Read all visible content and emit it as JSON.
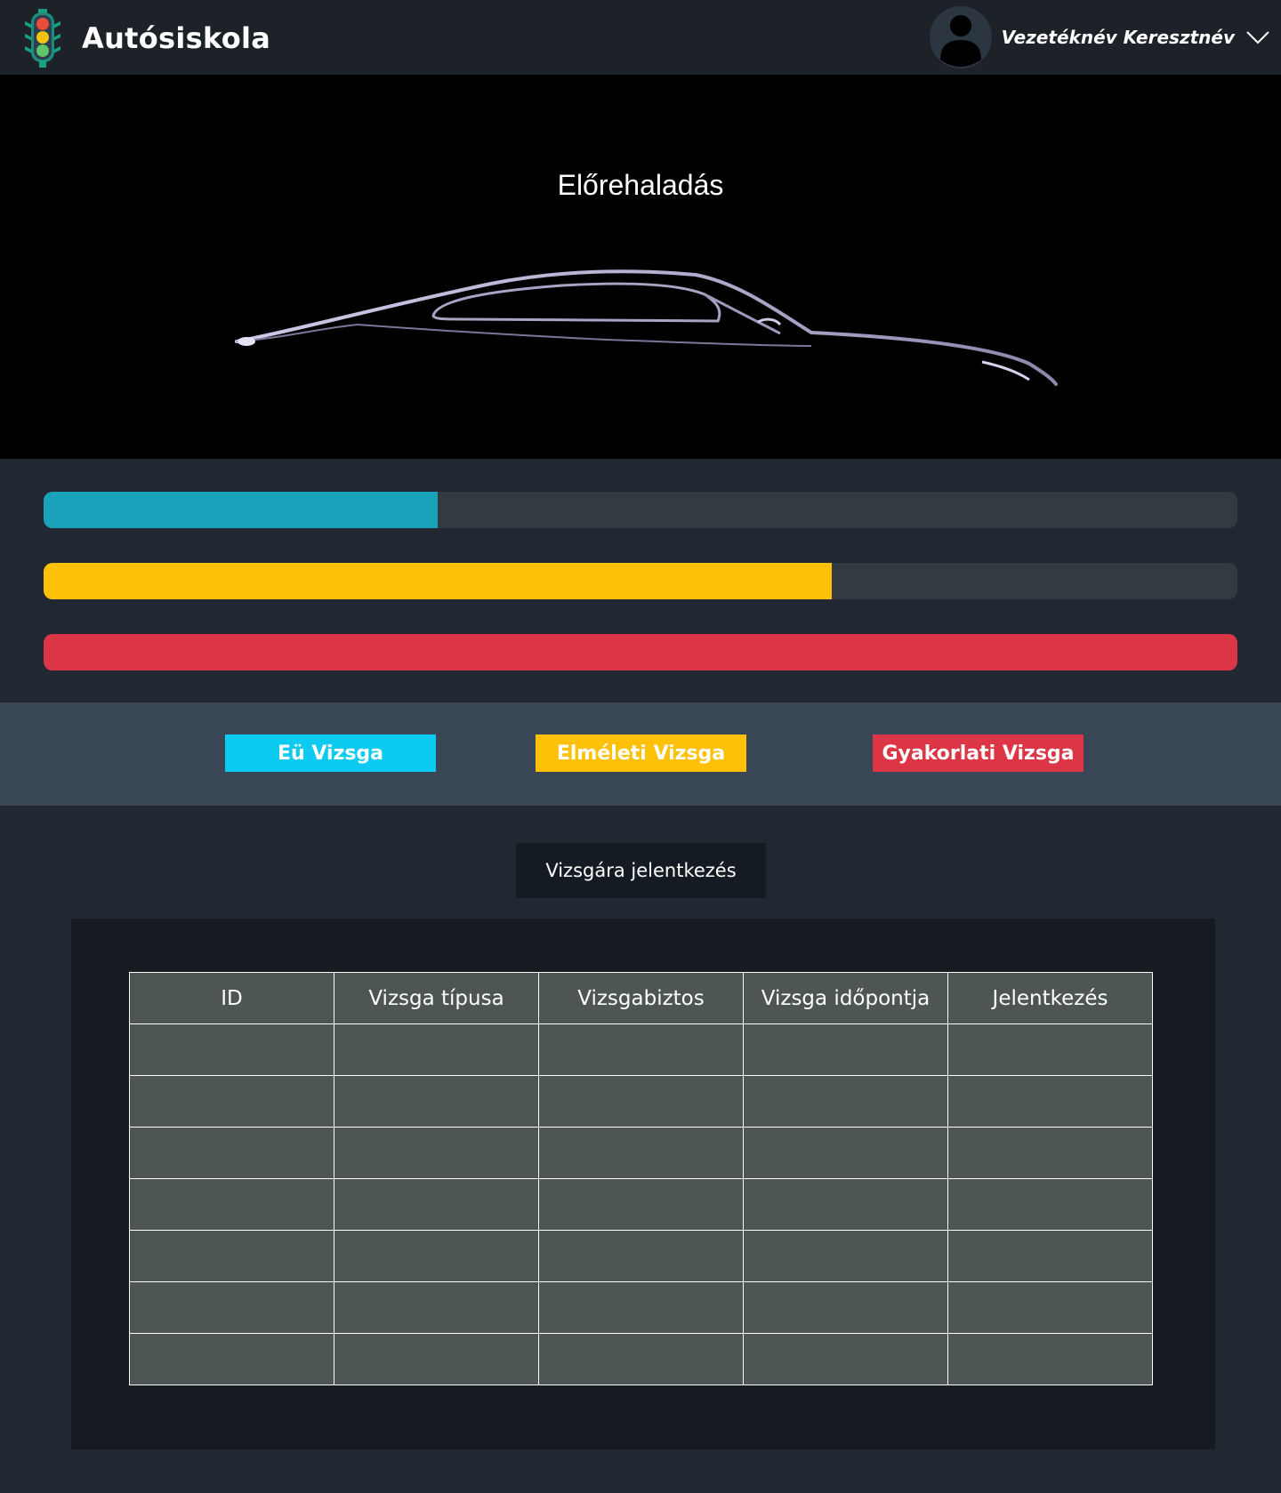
{
  "header": {
    "brand": "Autósiskola",
    "user_name": "Vezetéknév Keresztnév"
  },
  "hero": {
    "title": "Előrehaladás"
  },
  "progress": [
    {
      "fraction": 0.33,
      "color": "#1aa2ba"
    },
    {
      "fraction": 0.66,
      "color": "#ffc107"
    },
    {
      "fraction": 1.0,
      "color": "#dc3545"
    }
  ],
  "tabs": [
    {
      "label": "Eü Vizsga",
      "color": "#0dcaf0"
    },
    {
      "label": "Elméleti Vizsga",
      "color": "#ffc107"
    },
    {
      "label": "Gyakorlati Vizsga",
      "color": "#dc3545"
    }
  ],
  "apply_button": "Vizsgára jelentkezés",
  "table": {
    "headers": [
      "ID",
      "Vizsga típusa",
      "Vizsgabiztos",
      "Vizsga időpontja",
      "Jelentkezés"
    ],
    "rows": [
      [
        "",
        "",
        "",
        "",
        ""
      ],
      [
        "",
        "",
        "",
        "",
        ""
      ],
      [
        "",
        "",
        "",
        "",
        ""
      ],
      [
        "",
        "",
        "",
        "",
        ""
      ],
      [
        "",
        "",
        "",
        "",
        ""
      ],
      [
        "",
        "",
        "",
        "",
        ""
      ],
      [
        "",
        "",
        "",
        "",
        ""
      ]
    ]
  }
}
